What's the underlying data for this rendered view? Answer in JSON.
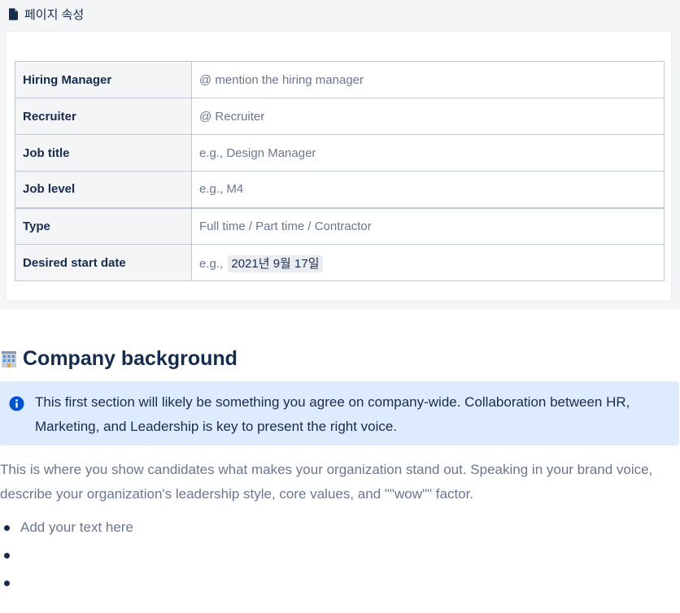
{
  "properties": {
    "header_label": "페이지 속성",
    "header_icon": "document-icon",
    "rows": [
      {
        "key": "Hiring Manager",
        "value": "@ mention the hiring manager"
      },
      {
        "key": "Recruiter",
        "value": "@ Recruiter"
      },
      {
        "key": "Job title",
        "value": "e.g., Design Manager"
      },
      {
        "key": "Job level",
        "value": "e.g., M4"
      },
      {
        "key": "Type",
        "value": "Full time / Part time / Contractor"
      },
      {
        "key": "Desired start date",
        "value_prefix": "e.g.,",
        "date_chip": "2021년 9월 17일"
      }
    ]
  },
  "section": {
    "emoji": "office-building-icon",
    "title": "Company background"
  },
  "info_panel": {
    "icon": "info-icon",
    "color": "#deebff",
    "text": "This first section will likely be something you agree on company-wide. Collaboration between HR, Marketing, and Leadership is key to present the right voice."
  },
  "body": {
    "paragraph": "This is where you show candidates what makes your organization stand out. Speaking in your brand voice, describe your organization's leadership style, core values, and \"\"wow\"\" factor."
  },
  "bullets": [
    "Add your text here",
    "",
    ""
  ],
  "colors": {
    "text_primary": "#172b4d",
    "text_secondary": "#6b778c",
    "panel_bg": "#f4f5f7",
    "info_icon": "#0052cc"
  }
}
